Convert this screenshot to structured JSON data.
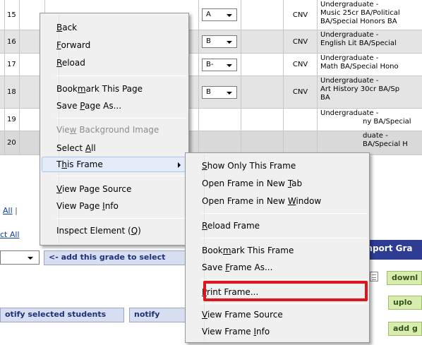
{
  "rows": [
    {
      "num": "15",
      "id": "1",
      "grade": "A",
      "status": "CNV",
      "program": [
        "Undergraduate -",
        "Music 25cr BA/Political",
        "BA/Special Honors BA"
      ]
    },
    {
      "num": "16",
      "id": "1",
      "grade": "B",
      "status": "CNV",
      "program": [
        "Undergraduate -",
        "English Lit BA/Special"
      ]
    },
    {
      "num": "17",
      "id": "2",
      "grade": "B-",
      "status": "CNV",
      "program": [
        "Undergraduate -",
        "Math BA/Special Hono"
      ]
    },
    {
      "num": "18",
      "id": "1",
      "grade": "B",
      "status": "CNV",
      "program": [
        "Undergraduate -",
        "Art History 30cr BA/Sp",
        "BA"
      ]
    },
    {
      "num": "19",
      "id": "1",
      "grade": "",
      "status": "",
      "program": [
        "Undergraduate -",
        "ny BA/Special"
      ]
    },
    {
      "num": "20",
      "id": "1",
      "grade": "",
      "status": "",
      "program": [
        "duate -",
        "BA/Special H"
      ]
    }
  ],
  "lower": {
    "all_link": "All",
    "all_sep": "|",
    "select_all_link": "ct All",
    "add_grade_button": "<- add this grade to select",
    "import_header": "Import Gra",
    "download_button": "downl",
    "upload_button": "uplo",
    "add_g_button": "add g",
    "notify_selected_button": "otify selected students",
    "notify_button": "notify"
  },
  "context_menu": {
    "back": {
      "pre": "",
      "key": "B",
      "post": "ack"
    },
    "forward": {
      "pre": "",
      "key": "F",
      "post": "orward"
    },
    "reload": {
      "pre": "",
      "key": "R",
      "post": "eload"
    },
    "bookmark": {
      "pre": "Book",
      "key": "m",
      "post": "ark This Page"
    },
    "save_page": {
      "pre": "Save ",
      "key": "P",
      "post": "age As..."
    },
    "view_bg": {
      "pre": "Vie",
      "key": "w",
      "post": " Background Image"
    },
    "select_all": {
      "pre": "Select ",
      "key": "A",
      "post": "ll"
    },
    "this_frame": {
      "pre": "T",
      "key": "h",
      "post": "is Frame"
    },
    "view_source": {
      "pre": "",
      "key": "V",
      "post": "iew Page Source"
    },
    "view_info": {
      "pre": "View Page ",
      "key": "I",
      "post": "nfo"
    },
    "inspect": {
      "pre": "Inspect Element (",
      "key": "Q",
      "post": ")"
    }
  },
  "submenu": {
    "show_only": {
      "pre": "",
      "key": "S",
      "post": "how Only This Frame"
    },
    "new_tab": {
      "pre": "Open Frame in New ",
      "key": "T",
      "post": "ab"
    },
    "new_window": {
      "pre": "Open Frame in New ",
      "key": "W",
      "post": "indow"
    },
    "reload_frame": {
      "pre": "",
      "key": "R",
      "post": "eload Frame"
    },
    "bookmark_frame": {
      "pre": "Book",
      "key": "m",
      "post": "ark This Frame"
    },
    "save_frame": {
      "pre": "Save ",
      "key": "F",
      "post": "rame As..."
    },
    "print_frame": {
      "pre": "",
      "key": "P",
      "post": "rint Frame..."
    },
    "view_frame_source": {
      "pre": "",
      "key": "V",
      "post": "iew Frame Source"
    },
    "view_frame_info": {
      "pre": "View Frame ",
      "key": "I",
      "post": "nfo"
    }
  },
  "colors": {
    "highlight_box": "#e0141b",
    "menu_bg": "#f0f0f0",
    "import_bar": "#2f3c93"
  }
}
